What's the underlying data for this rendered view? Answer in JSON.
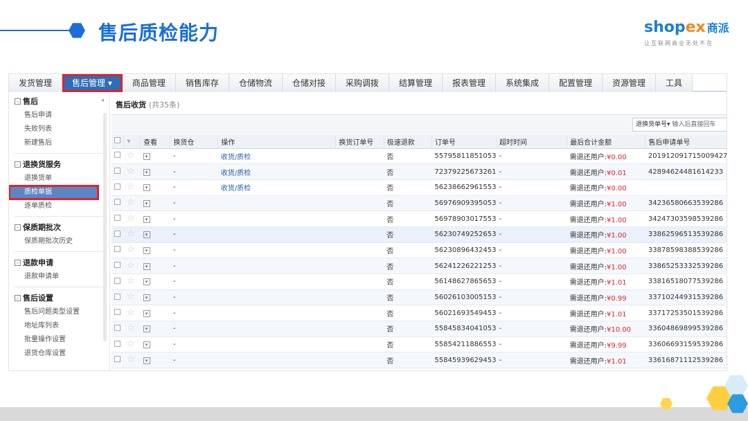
{
  "slide": {
    "title": "售后质检能力",
    "logo_main": "shop",
    "logo_ex": "ex",
    "logo_cn": "商派",
    "logo_sub": "让互联网商业无处不在",
    "accent": "#1a6fd6"
  },
  "nav": {
    "items": [
      "发货管理",
      "售后管理 ▾",
      "商品管理",
      "销售库存",
      "仓储物流",
      "仓储对接",
      "采购调拨",
      "结算管理",
      "报表管理",
      "系统集成",
      "配置管理",
      "资源管理",
      "工具"
    ]
  },
  "sidebar": {
    "groups": [
      {
        "label": "售后",
        "items": [
          "售后申请",
          "失败列表",
          "新建售后"
        ]
      },
      {
        "label": "退换货服务",
        "items": [
          "退换货单",
          "质检单据",
          "逐单质检"
        ]
      },
      {
        "label": "保质期批次",
        "items": [
          "保质期批次历史"
        ]
      },
      {
        "label": "退款申请",
        "items": [
          "退款申请单"
        ]
      },
      {
        "label": "售后设置",
        "items": [
          "售后问题类型设置",
          "地址库列表",
          "批量操作设置",
          "退货仓库设置"
        ]
      }
    ]
  },
  "main": {
    "title": "售后收货",
    "count": "(共35条)",
    "search_label": "退换货单号▾",
    "search_placeholder": "输入后直接回车",
    "columns": [
      "",
      "",
      "查看",
      "换货仓",
      "操作",
      "换货订单号",
      "极速退款",
      "订单号",
      "超时时间",
      "最后合计金额",
      "售后申请单号"
    ],
    "rows": [
      {
        "op": "收货/质检",
        "fast": "否",
        "order": "55795811851053",
        "amount": "¥0.00",
        "apply": "201912091715009427"
      },
      {
        "op": "收货/质检",
        "fast": "否",
        "order": "72379225673261",
        "amount": "¥0.01",
        "apply": "42894624481614233"
      },
      {
        "op": "收货/质检",
        "fast": "否",
        "order": "56238662961553",
        "amount": "¥0.00",
        "apply": ""
      },
      {
        "op": "",
        "fast": "否",
        "order": "56976909395053",
        "amount": "¥1.00",
        "apply": "34236580663539286"
      },
      {
        "op": "",
        "fast": "否",
        "order": "56978903017553",
        "amount": "¥1.00",
        "apply": "34247303598539286"
      },
      {
        "op": "",
        "fast": "否",
        "order": "56230749252653",
        "amount": "¥1.00",
        "apply": "33862596513539286"
      },
      {
        "op": "",
        "fast": "否",
        "order": "56230896432453",
        "amount": "¥1.00",
        "apply": "33878598388539286"
      },
      {
        "op": "",
        "fast": "否",
        "order": "56241226221253",
        "amount": "¥1.00",
        "apply": "33865253332539286"
      },
      {
        "op": "",
        "fast": "否",
        "order": "56148627865653",
        "amount": "¥1.01",
        "apply": "33816518077539286"
      },
      {
        "op": "",
        "fast": "否",
        "order": "56026103005153",
        "amount": "¥0.99",
        "apply": "33710244931539286"
      },
      {
        "op": "",
        "fast": "否",
        "order": "56021693549453",
        "amount": "¥1.01",
        "apply": "33717253501539286"
      },
      {
        "op": "",
        "fast": "否",
        "order": "55845834041053",
        "amount": "¥10.00",
        "apply": "33604869899539286"
      },
      {
        "op": "",
        "fast": "否",
        "order": "55854211886553",
        "amount": "¥9.99",
        "apply": "33606693159539286"
      },
      {
        "op": "",
        "fast": "否",
        "order": "55845939629453",
        "amount": "¥1.01",
        "apply": "33616871112539286"
      }
    ],
    "dash": "-",
    "amount_prefix": "需退还用户:"
  }
}
